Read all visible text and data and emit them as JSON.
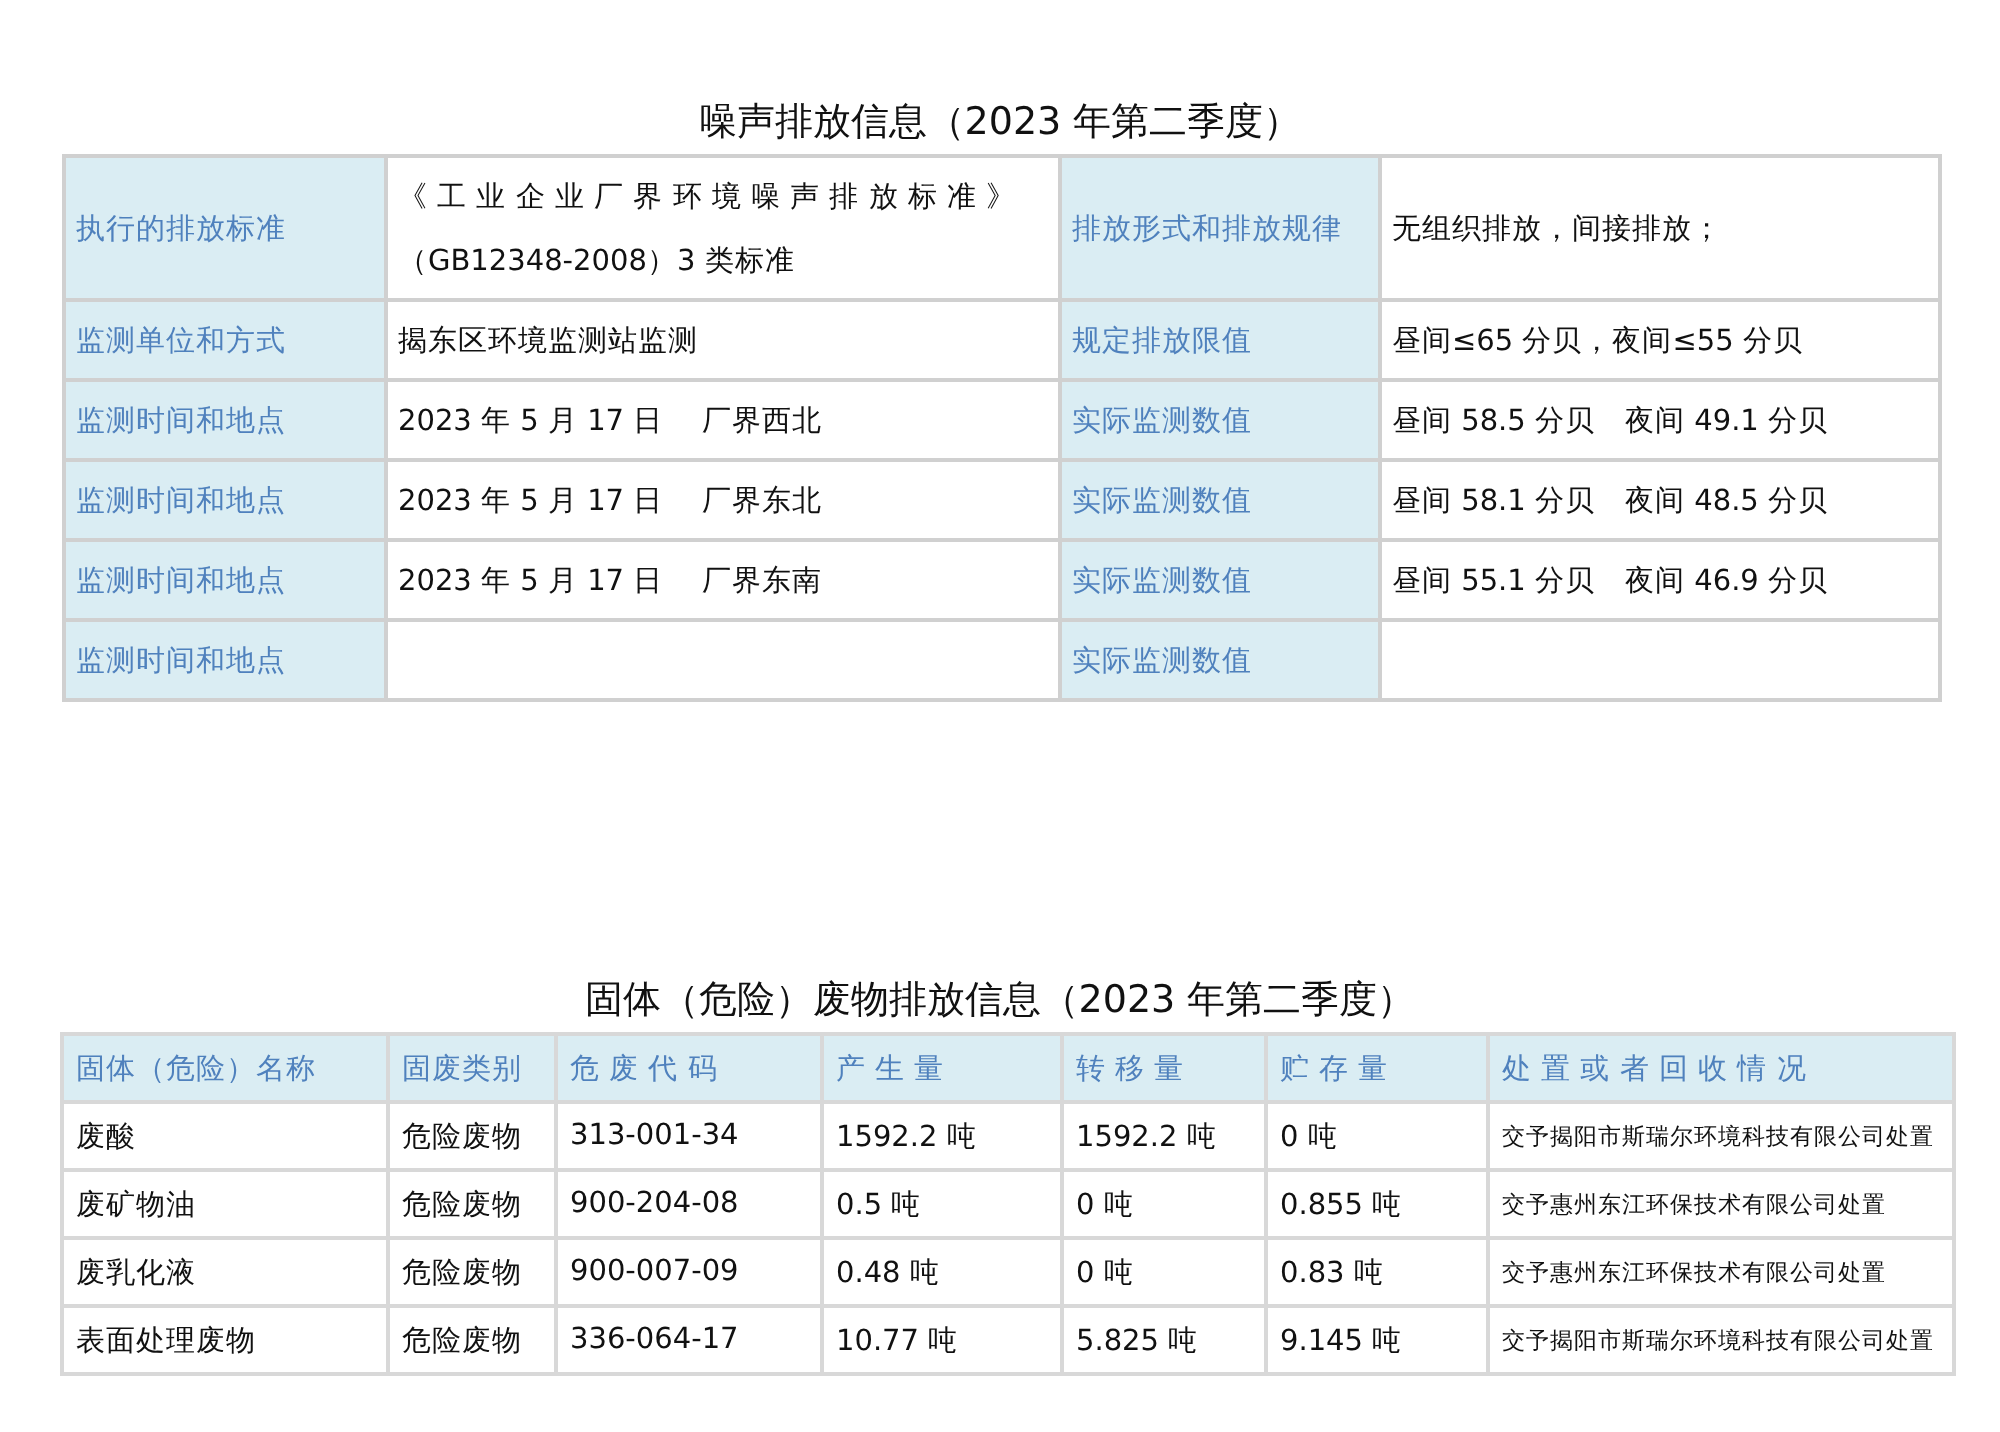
{
  "noise_section": {
    "title": "噪声排放信息（2023 年第二季度）",
    "rows": [
      {
        "label_1": "执行的排放标准",
        "value_1": "《 工 业 企 业 厂 界 环 境 噪 声 排 放 标 准 》（GB12348-2008）3 类标准",
        "label_2": "排放形式和排放规律",
        "value_2": "无组织排放，间接排放；"
      },
      {
        "label_1": "监测单位和方式",
        "value_1": "揭东区环境监测站监测",
        "label_2": "规定排放限值",
        "value_2": "昼间≤65 分贝，夜间≤55 分贝"
      },
      {
        "label_1": "监测时间和地点",
        "value_1": "2023 年 5 月 17 日　 厂界西北",
        "label_2": "实际监测数值",
        "value_2": "昼间 58.5 分贝　夜间 49.1 分贝"
      },
      {
        "label_1": "监测时间和地点",
        "value_1": "2023 年 5 月 17 日　 厂界东北",
        "label_2": "实际监测数值",
        "value_2": "昼间 58.1 分贝　夜间 48.5 分贝"
      },
      {
        "label_1": "监测时间和地点",
        "value_1": "2023 年 5 月 17 日　 厂界东南",
        "label_2": "实际监测数值",
        "value_2": "昼间 55.1 分贝　夜间 46.9 分贝"
      },
      {
        "label_1": "监测时间和地点",
        "label_2": "实际监测数值"
      }
    ]
  },
  "waste_section": {
    "title": "固体（危险）废物排放信息（2023 年第二季度）",
    "columns": [
      "固体（危险）名称",
      "固废类别",
      "危 废 代 码",
      "产 生 量",
      "转 移 量",
      "贮 存 量",
      "处 置 或 者 回 收 情 况"
    ],
    "rows": [
      [
        "废酸",
        "危险废物",
        "313-001-34",
        "1592.2 吨",
        "1592.2 吨",
        "0 吨",
        "交予揭阳市斯瑞尔环境科技有限公司处置"
      ],
      [
        "废矿物油",
        "危险废物",
        "900-204-08",
        "0.5 吨",
        "0 吨",
        "0.855 吨",
        "交予惠州东江环保技术有限公司处置"
      ],
      [
        "废乳化液",
        "危险废物",
        "900-007-09",
        "0.48 吨",
        "0 吨",
        "0.83 吨",
        "交予惠州东江环保技术有限公司处置"
      ],
      [
        "表面处理废物",
        "危险废物",
        "336-064-17",
        "10.77 吨",
        "5.825 吨",
        "9.145 吨",
        "交予揭阳市斯瑞尔环境科技有限公司处置"
      ]
    ]
  }
}
